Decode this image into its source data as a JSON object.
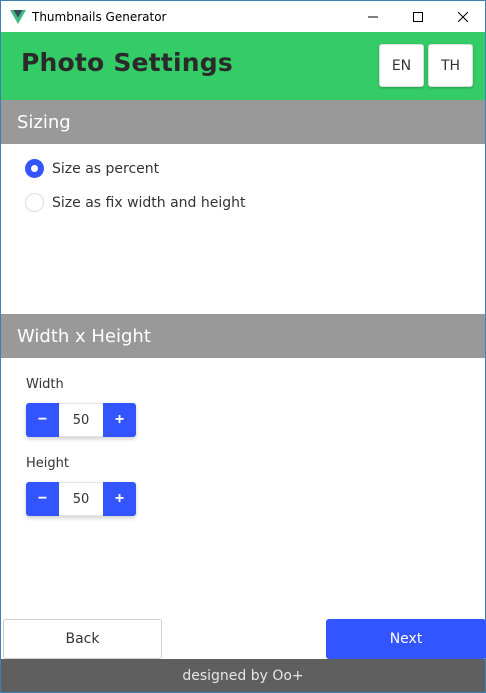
{
  "window": {
    "title": "Thumbnails Generator",
    "icon": "vue-logo-icon",
    "controls": [
      "minimize-icon",
      "maximize-icon",
      "close-icon"
    ]
  },
  "header": {
    "title": "Photo Settings",
    "lang_en": "EN",
    "lang_th": "TH",
    "color": "#33cc66"
  },
  "sizing": {
    "heading": "Sizing",
    "options": [
      {
        "label": "Size as percent",
        "selected": true
      },
      {
        "label": "Size as fix width and height",
        "selected": false
      }
    ]
  },
  "dimensions": {
    "heading": "Width x Height",
    "width_label": "Width",
    "width_value": "50",
    "height_label": "Height",
    "height_value": "50",
    "minus": "−",
    "plus": "+"
  },
  "nav": {
    "back": "Back",
    "next": "Next"
  },
  "footer": {
    "text": "designed by Oo+"
  },
  "colors": {
    "accent": "#3355ff",
    "section": "#999999",
    "footer": "#5f5f5f"
  }
}
